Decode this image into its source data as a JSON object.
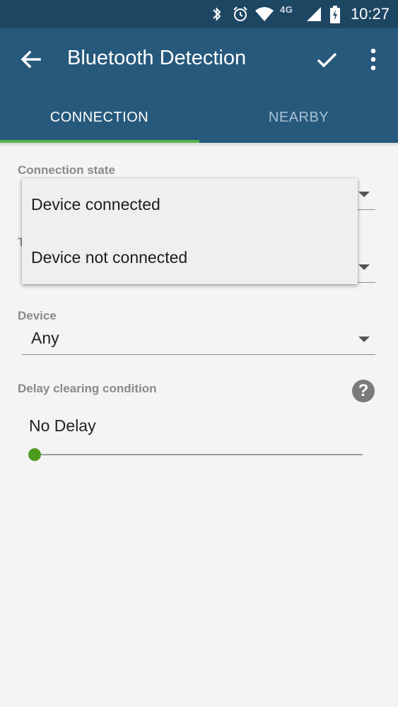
{
  "status_bar": {
    "time": "10:27",
    "network": "4G",
    "icons": [
      "bluetooth-icon",
      "alarm-icon",
      "wifi-icon",
      "signal-icon",
      "battery-icon"
    ]
  },
  "app_bar": {
    "title": "Bluetooth Detection",
    "back_icon": "arrow-back-icon",
    "confirm_icon": "check-icon",
    "menu_icon": "more-vert-icon"
  },
  "tabs": [
    {
      "label": "CONNECTION",
      "active": true
    },
    {
      "label": "NEARBY",
      "active": false
    }
  ],
  "form": {
    "connection_state": {
      "label": "Connection state",
      "options": [
        "Device connected",
        "Device not connected"
      ]
    },
    "hidden_label_initial": "T",
    "device": {
      "label": "Device",
      "value": "Any"
    },
    "delay": {
      "label": "Delay clearing condition",
      "value": "No Delay",
      "slider_level": 0,
      "help_glyph": "?"
    }
  },
  "colors": {
    "app_bar": "#27597c",
    "status_bar": "#1d4663",
    "accent": "#5ab34a",
    "slider_thumb": "#4e9c1e"
  }
}
